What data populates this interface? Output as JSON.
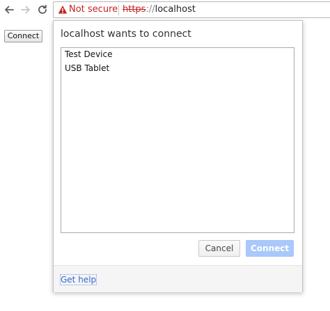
{
  "browser": {
    "back_icon": "arrow-left-icon",
    "forward_icon": "arrow-right-icon",
    "reload_icon": "reload-icon",
    "security_icon": "warning-triangle-icon",
    "security_label": "Not secure",
    "url_scheme": "https",
    "url_separator": "://",
    "url_host": "localhost",
    "warning_color": "#c5221f"
  },
  "page": {
    "connect_label": "Connect"
  },
  "dialog": {
    "title": "localhost wants to connect",
    "devices": [
      {
        "label": "Test Device"
      },
      {
        "label": "USB Tablet"
      }
    ],
    "cancel_label": "Cancel",
    "connect_label": "Connect",
    "connect_enabled": false,
    "help_label": "Get help",
    "accent_color": "#a9c8fb",
    "link_color": "#3367d6"
  }
}
